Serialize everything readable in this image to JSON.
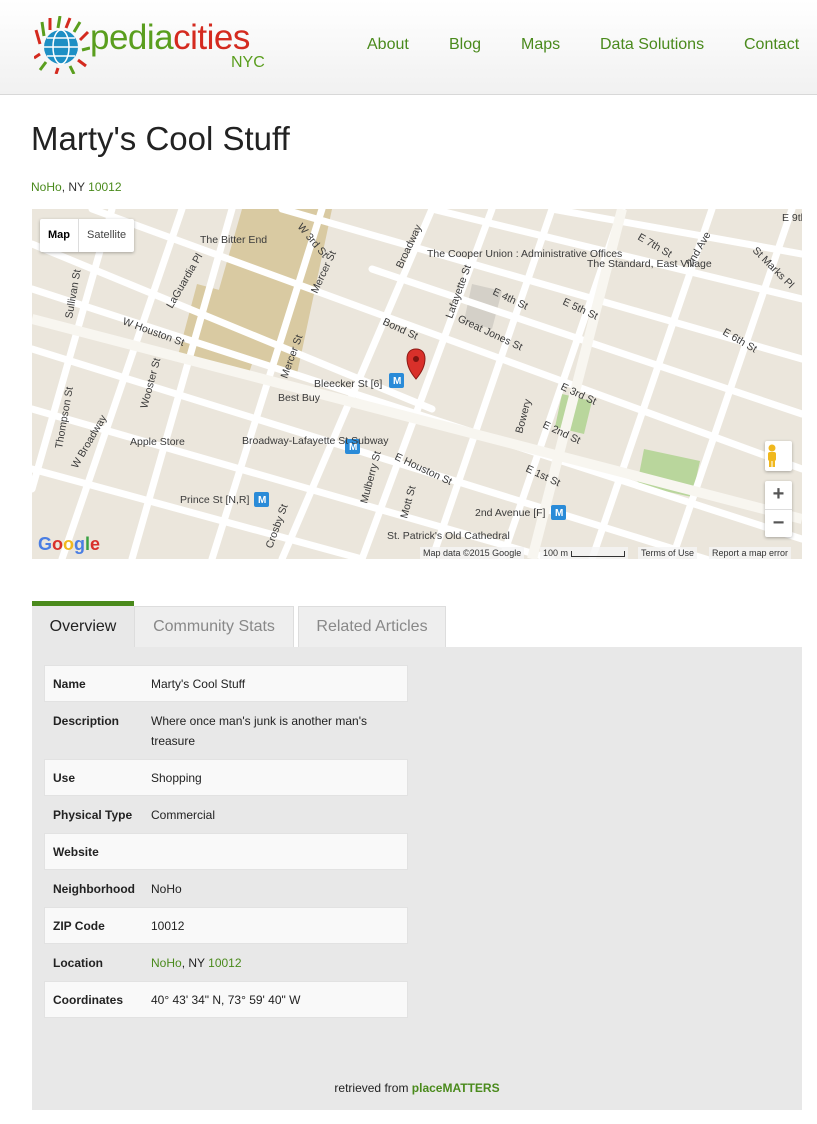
{
  "brand": {
    "name_part1": "pedia",
    "name_part2": "cities",
    "sub": "NYC",
    "colors": {
      "green": "#5a9e1e",
      "red": "#d42a1f"
    }
  },
  "nav": {
    "items": [
      "About",
      "Blog",
      "Maps",
      "Data Solutions",
      "Contact"
    ]
  },
  "page": {
    "title": "Marty's Cool Stuff",
    "address": {
      "neighborhood": "NoHo",
      "state": ", NY ",
      "zip": "10012"
    }
  },
  "map": {
    "type_buttons": [
      "Map",
      "Satellite"
    ],
    "labels": [
      "The Bitter End",
      "W 3rd St",
      "Broadway",
      "The Cooper Union : Administrative Offices",
      "E 7th St",
      "St Marks Pl",
      "E 9th",
      "The Standard, East Village",
      "2nd Ave",
      "LaGuardia Pl",
      "Mercer St",
      "Sullivan St",
      "W Houston St",
      "Lafayette St",
      "E 4th St",
      "Great Jones St",
      "E 5th St",
      "E 6th St",
      "Bond St",
      "Mercer St",
      "Wooster St",
      "Bleecker St [6]",
      "Best Buy",
      "Thompson St",
      "W Broadway",
      "Apple Store",
      "Broadway-Lafayette St Subway",
      "E 3rd St",
      "E 2nd St",
      "Bowery",
      "E 1st St",
      "E Houston St",
      "Prince St [N,R]",
      "Mulberry St",
      "Mott St",
      "2nd Avenue [F]",
      "St. Patrick's Old Cathedral",
      "Crosby St"
    ],
    "footer": {
      "data": "Map data ©2015 Google",
      "scale": "100 m",
      "terms": "Terms of Use",
      "report": "Report a map error"
    },
    "zoom_in": "+",
    "zoom_out": "−",
    "google_logo": "Google"
  },
  "tabs": [
    "Overview",
    "Community Stats",
    "Related Articles"
  ],
  "overview": {
    "rows": [
      {
        "label": "Name",
        "value": "Marty's Cool Stuff"
      },
      {
        "label": "Description",
        "value": "Where once man's junk is another man's treasure"
      },
      {
        "label": "Use",
        "value": "Shopping"
      },
      {
        "label": "Physical Type",
        "value": "Commercial"
      },
      {
        "label": "Website",
        "value": ""
      },
      {
        "label": "Neighborhood",
        "value": "NoHo"
      },
      {
        "label": "ZIP Code",
        "value": "10012"
      },
      {
        "label": "Location",
        "value_link1": "NoHo",
        "value_text": ", NY ",
        "value_link2": "10012"
      },
      {
        "label": "Coordinates",
        "value": "40° 43' 34\" N, 73° 59' 40\" W"
      }
    ],
    "retrieved_prefix": "retrieved from ",
    "retrieved_source": "placeMATTERS"
  }
}
